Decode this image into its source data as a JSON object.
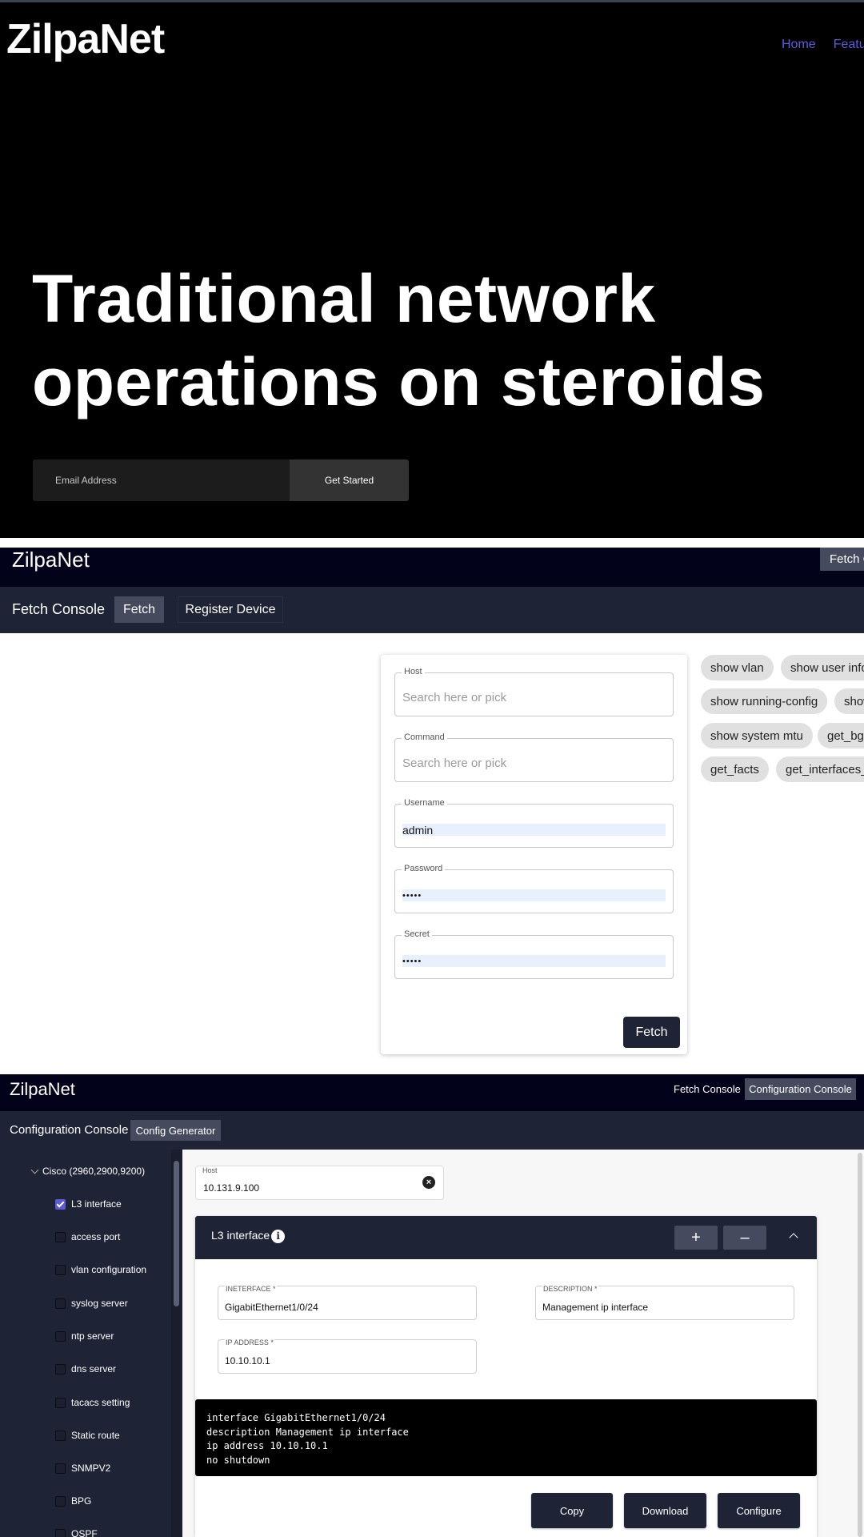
{
  "hero": {
    "logo": "ZilpaNet",
    "nav": [
      "Home",
      "Features"
    ],
    "title_line1": "Traditional network",
    "title_line2": "operations on steroids",
    "email_placeholder": "Email Address",
    "cta": "Get Started"
  },
  "fetch_app": {
    "logo": "ZilpaNet",
    "top_button": "Fetch Console",
    "subtitle": "Fetch Console",
    "tabs": [
      "Fetch",
      "Register Device"
    ],
    "form": {
      "host_label": "Host",
      "host_placeholder": "Search here or pick",
      "command_label": "Command",
      "command_placeholder": "Search here or pick",
      "username_label": "Username",
      "username_value": "admin",
      "password_label": "Password",
      "password_value": "•••••",
      "secret_label": "Secret",
      "secret_value": "•••••",
      "submit": "Fetch"
    },
    "command_chips": [
      "show vlan",
      "show user info",
      "show running-config",
      "show",
      "show system mtu",
      "get_bgp",
      "get_facts",
      "get_interfaces_"
    ]
  },
  "config_app": {
    "logo": "ZilpaNet",
    "nav": [
      "Fetch Console",
      "Configuration Console"
    ],
    "subtitle": "Configuration Console",
    "tab": "Config Generator",
    "tree": {
      "group": "Cisco (2960,2900,9200)",
      "items": [
        {
          "label": "L3 interface",
          "checked": true
        },
        {
          "label": "access port",
          "checked": false
        },
        {
          "label": "vlan configuration",
          "checked": false
        },
        {
          "label": "syslog server",
          "checked": false
        },
        {
          "label": "ntp server",
          "checked": false
        },
        {
          "label": "dns server",
          "checked": false
        },
        {
          "label": "tacacs setting",
          "checked": false
        },
        {
          "label": "Static route",
          "checked": false
        },
        {
          "label": "SNMPV2",
          "checked": false
        },
        {
          "label": "BPG",
          "checked": false
        },
        {
          "label": "OSPF",
          "checked": false
        }
      ]
    },
    "host": {
      "label": "Host",
      "value": "10.131.9.100"
    },
    "panel": {
      "title": "L3 interface",
      "add": "+",
      "remove": "–",
      "fields": {
        "interface_label": "INETERFACE *",
        "interface_value": "GigabitEthernet1/0/24",
        "description_label": "DESCRIPTION *",
        "description_value": "Management ip interface",
        "ip_label": "IP ADDRESS *",
        "ip_value": "10.10.10.1"
      },
      "code_lines": [
        "interface GigabitEthernet1/0/24",
        "description Management ip interface",
        "ip address 10.10.10.1",
        "no shutdown"
      ],
      "actions": [
        "Copy",
        "Download",
        "Configure"
      ]
    }
  }
}
